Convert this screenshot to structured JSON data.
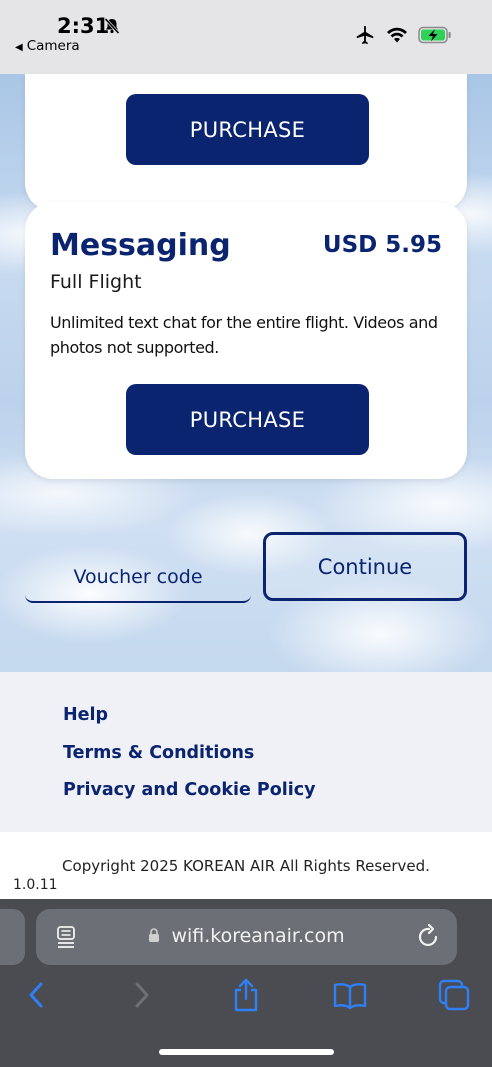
{
  "status_bar": {
    "time": "2:31",
    "back_app": "Camera"
  },
  "top_card": {
    "button_label": "PURCHASE"
  },
  "plan": {
    "name": "Messaging",
    "price": "USD 5.95",
    "duration": "Full Flight",
    "description": "Unlimited text chat for the entire flight. Videos and photos not supported.",
    "button_label": "PURCHASE"
  },
  "voucher": {
    "placeholder": "Voucher code"
  },
  "continue_label": "Continue",
  "footer": {
    "links": [
      "Help",
      "Terms & Conditions",
      "Privacy and Cookie Policy"
    ],
    "copyright": "Copyright 2025 KOREAN AIR All Rights Reserved.",
    "version": "1.0.11"
  },
  "browser": {
    "url": "wifi.koreanair.com"
  },
  "colors": {
    "brand_navy": "#0b2470",
    "battery_green": "#30d158"
  }
}
